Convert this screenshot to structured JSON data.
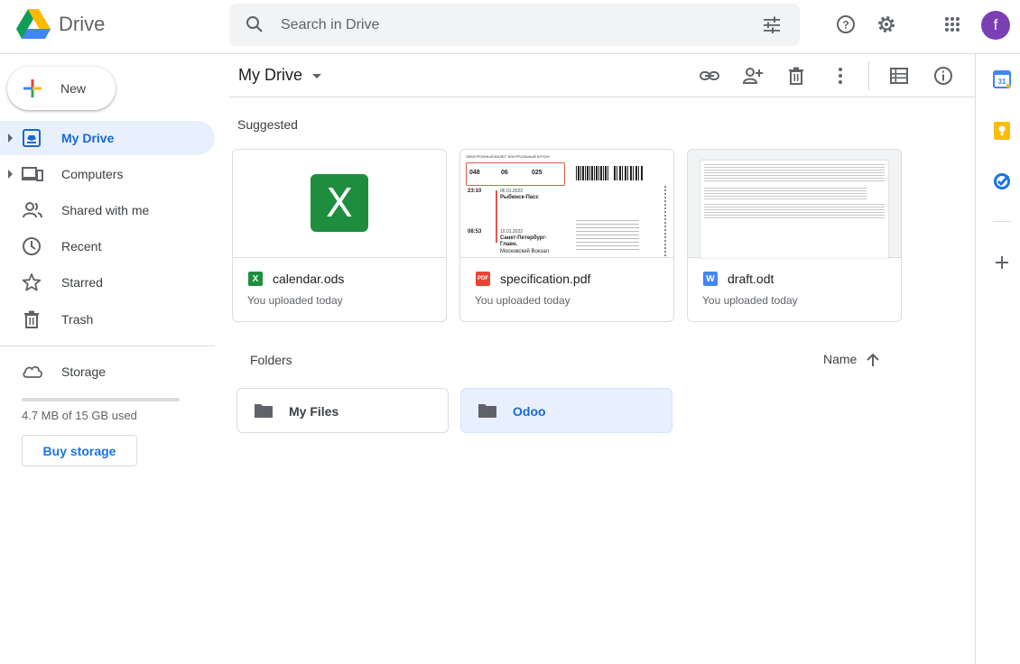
{
  "app": {
    "name": "Drive"
  },
  "search": {
    "placeholder": "Search in Drive"
  },
  "user": {
    "initial": "f"
  },
  "sidebar": {
    "new_label": "New",
    "items": [
      {
        "label": "My Drive",
        "icon": "my-drive-icon",
        "active": true
      },
      {
        "label": "Computers",
        "icon": "computers-icon"
      },
      {
        "label": "Shared with me",
        "icon": "shared-icon"
      },
      {
        "label": "Recent",
        "icon": "clock-icon"
      },
      {
        "label": "Starred",
        "icon": "star-icon"
      },
      {
        "label": "Trash",
        "icon": "trash-icon"
      }
    ],
    "storage_label": "Storage",
    "storage_used_text": "4.7 MB of 15 GB used",
    "storage_fraction": 0.0003,
    "buy_storage": "Buy storage"
  },
  "main": {
    "title": "My Drive",
    "suggested_label": "Suggested",
    "suggested": [
      {
        "name": "calendar.ods",
        "subtitle": "You uploaded today",
        "type": "sheet",
        "icon_color": "#1e8e3e",
        "icon_text": "X"
      },
      {
        "name": "specification.pdf",
        "subtitle": "You uploaded today",
        "type": "pdf",
        "icon_color": "#ea4335",
        "icon_text": "PDF"
      },
      {
        "name": "draft.odt",
        "subtitle": "You uploaded today",
        "type": "doc",
        "icon_color": "#4285f4",
        "icon_text": "W"
      }
    ],
    "folders_label": "Folders",
    "sort_label": "Name",
    "folders": [
      {
        "name": "My Files",
        "selected": false
      },
      {
        "name": "Odoo",
        "selected": true
      }
    ],
    "ticket": {
      "header": "ЭЛЕКТРОННЫЙ БИЛЕТ. КОНТРОЛЬНЫЙ КУПОН",
      "codes": [
        "048",
        "06",
        "025"
      ],
      "dep_time": "23:10",
      "dep_date": "06.01.2022",
      "dep_station": "Рыбинск-Пасс",
      "arr_time": "08:53",
      "arr_date": "10.01.2022",
      "arr_station": "Санкт-Петербург-Главн.",
      "arr_sub": "Московский Вокзал"
    }
  },
  "colors": {
    "accent": "#1a73e8",
    "active_bg": "#e8f0fe"
  }
}
